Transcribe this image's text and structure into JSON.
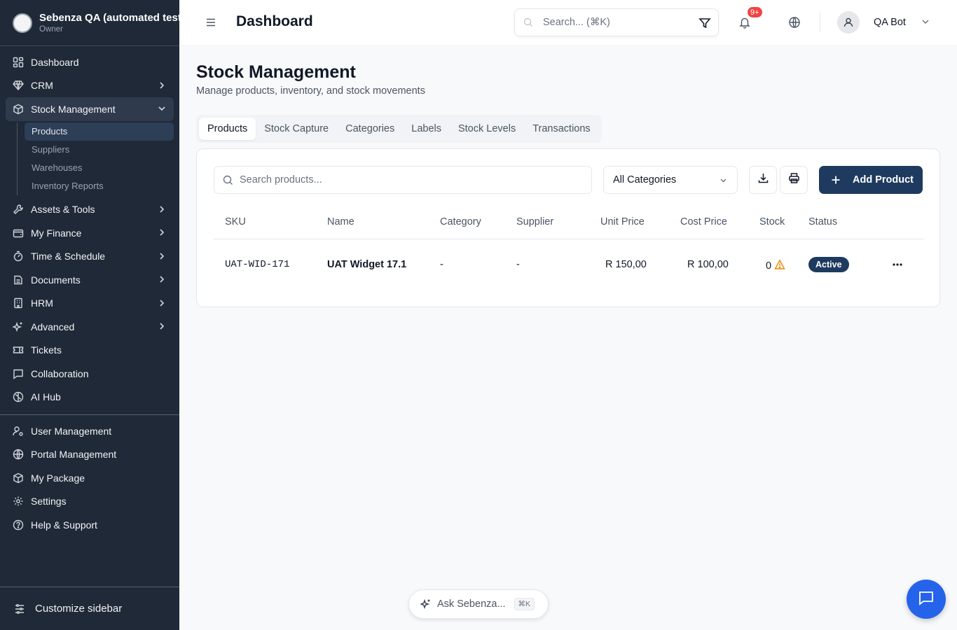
{
  "org": {
    "name": "Sebenza QA (automated tests)",
    "role": "Owner"
  },
  "sidebar": {
    "items": [
      {
        "label": "Dashboard",
        "icon": "dashboard-icon"
      },
      {
        "label": "CRM",
        "icon": "gem-icon"
      },
      {
        "label": "Stock Management",
        "icon": "package-icon"
      },
      {
        "label": "Assets & Tools",
        "icon": "wrench-icon"
      },
      {
        "label": "My Finance",
        "icon": "wallet-icon"
      },
      {
        "label": "Time & Schedule",
        "icon": "timer-icon"
      },
      {
        "label": "Documents",
        "icon": "document-icon"
      },
      {
        "label": "HRM",
        "icon": "building-icon"
      },
      {
        "label": "Advanced",
        "icon": "sparkles-icon"
      },
      {
        "label": "Tickets",
        "icon": "ticket-icon"
      },
      {
        "label": "Collaboration",
        "icon": "message-icon"
      },
      {
        "label": "AI Hub",
        "icon": "brain-icon"
      }
    ],
    "stock_sub": [
      "Products",
      "Suppliers",
      "Warehouses",
      "Inventory Reports"
    ],
    "bottom_items": [
      {
        "label": "User Management",
        "icon": "user-cog-icon"
      },
      {
        "label": "Portal Management",
        "icon": "globe-icon"
      },
      {
        "label": "My Package",
        "icon": "package-icon"
      },
      {
        "label": "Settings",
        "icon": "gear-icon"
      },
      {
        "label": "Help & Support",
        "icon": "help-icon"
      }
    ],
    "customize": "Customize sidebar"
  },
  "header": {
    "title": "Dashboard",
    "search_placeholder": "Search... (⌘K)",
    "notifications": "9+",
    "user": "QA Bot"
  },
  "page": {
    "title": "Stock Management",
    "subtitle": "Manage products, inventory, and stock movements",
    "tabs": [
      "Products",
      "Stock Capture",
      "Categories",
      "Labels",
      "Stock Levels",
      "Transactions"
    ],
    "active_tab": "Products"
  },
  "products": {
    "search_placeholder": "Search products...",
    "category_filter": "All Categories",
    "add_label": "Add Product",
    "columns": [
      "SKU",
      "Name",
      "Category",
      "Supplier",
      "Unit Price",
      "Cost Price",
      "Stock",
      "Status"
    ],
    "rows": [
      {
        "sku": "UAT-WID-171",
        "name": "UAT Widget 17.1",
        "category": "-",
        "supplier": "-",
        "unit_price": "R 150,00",
        "cost_price": "R 100,00",
        "stock": "0",
        "status": "Active"
      }
    ]
  },
  "assistant": {
    "label": "Ask Sebenza...",
    "shortcut": "⌘K"
  },
  "colors": {
    "sidebar": "#1f2937",
    "primary": "#1e3a5f",
    "chat": "#2563eb",
    "badge": "#ef4444",
    "warning": "#ea8a0c"
  }
}
